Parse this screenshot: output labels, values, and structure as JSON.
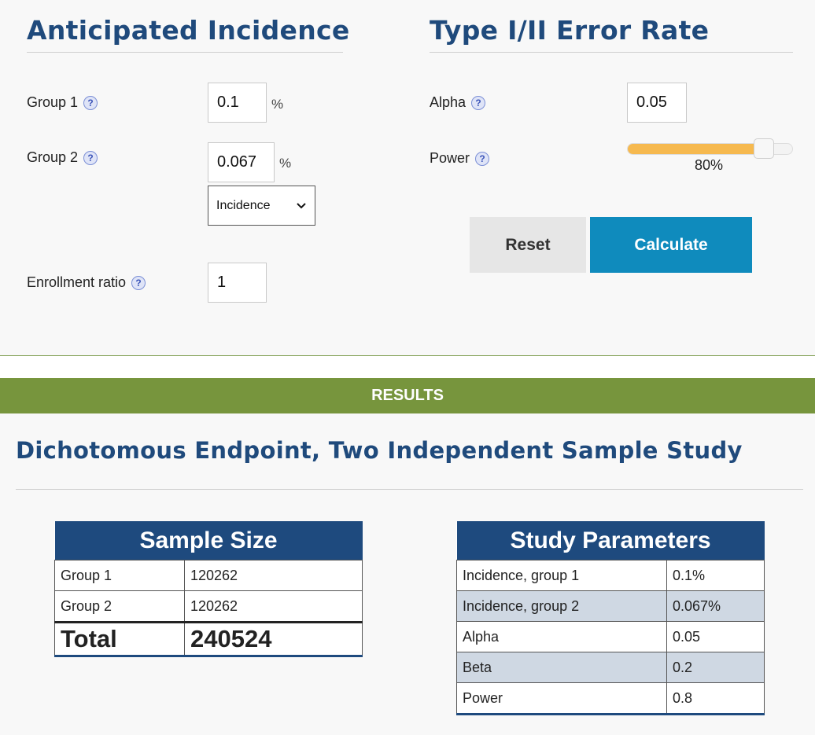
{
  "incidence": {
    "title": "Anticipated Incidence",
    "group1_label": "Group 1",
    "group1_value": "0.1",
    "group2_label": "Group 2",
    "group2_value": "0.067",
    "unit": "%",
    "select_value": "Incidence",
    "enrollment_label": "Enrollment ratio",
    "enrollment_value": "1",
    "help_glyph": "?"
  },
  "error_rate": {
    "title": "Type I/II Error Rate",
    "alpha_label": "Alpha",
    "alpha_value": "0.05",
    "power_label": "Power",
    "power_display": "80%",
    "power_fraction": 0.8,
    "reset_label": "Reset",
    "calculate_label": "Calculate"
  },
  "results": {
    "bar_label": "RESULTS",
    "study_title": "Dichotomous Endpoint, Two Independent Sample Study",
    "sample_size": {
      "title": "Sample Size",
      "rows": [
        {
          "label": "Group 1",
          "value": "120262"
        },
        {
          "label": "Group 2",
          "value": "120262"
        }
      ],
      "total_label": "Total",
      "total_value": "240524"
    },
    "study_parameters": {
      "title": "Study Parameters",
      "rows": [
        {
          "label": "Incidence, group 1",
          "value": "0.1%"
        },
        {
          "label": "Incidence, group 2",
          "value": "0.067%"
        },
        {
          "label": "Alpha",
          "value": "0.05"
        },
        {
          "label": "Beta",
          "value": "0.2"
        },
        {
          "label": "Power",
          "value": "0.8"
        }
      ]
    }
  },
  "colors": {
    "heading": "#1f4a7c",
    "results_bar": "#77953d",
    "calculate": "#0f8bbd",
    "slider_fill": "#f6b94f",
    "table_header": "#1e4a7e"
  },
  "icons": [
    "help-icon",
    "chevron-down-icon"
  ]
}
